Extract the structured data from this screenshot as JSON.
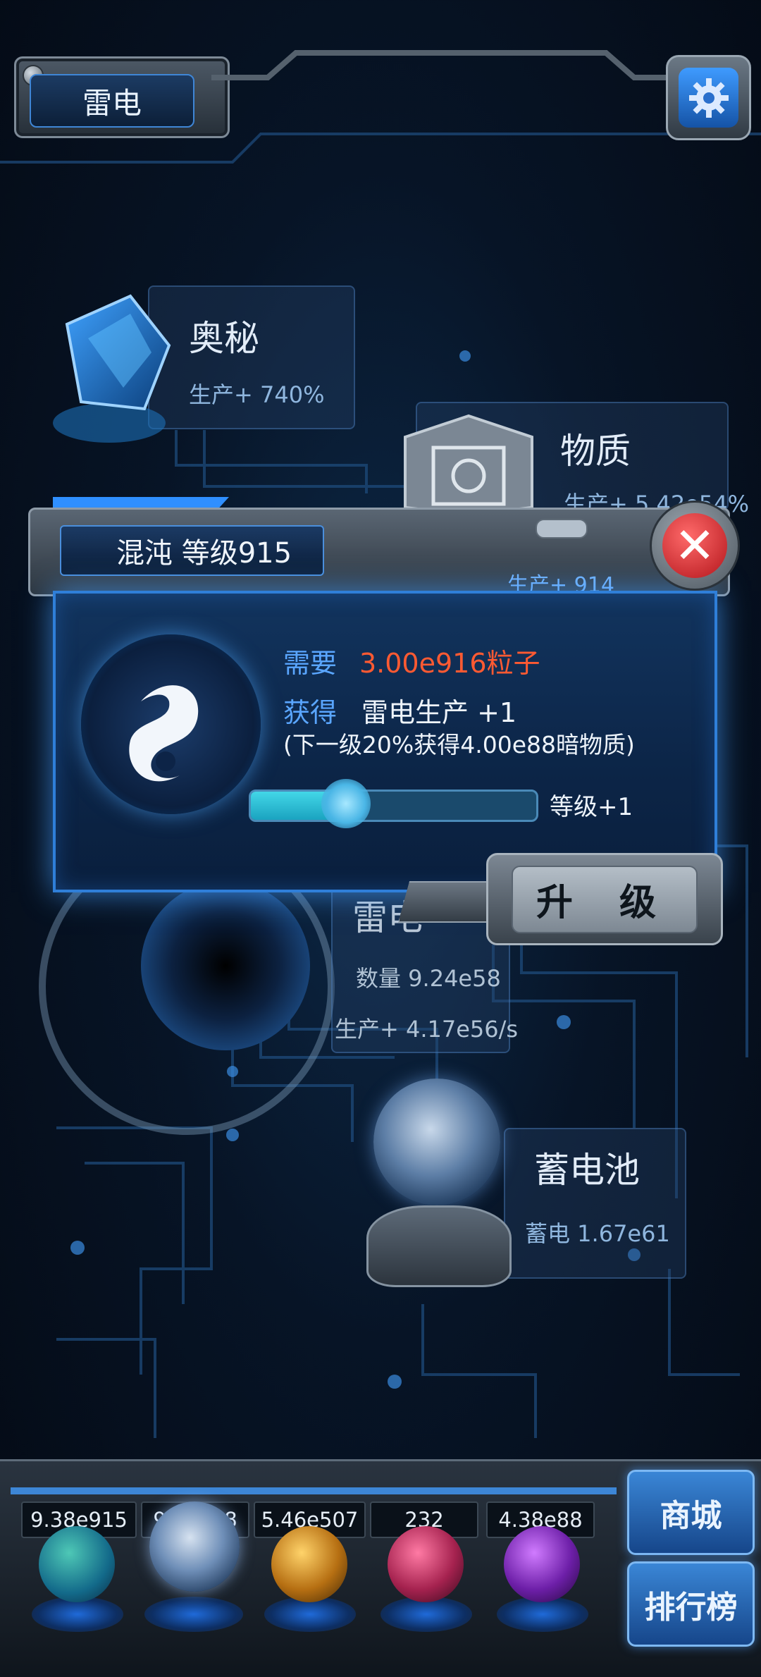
{
  "header": {
    "title": "雷电",
    "settings_icon": "gear-icon"
  },
  "cards": {
    "mystery": {
      "title": "奥秘",
      "production": "生产+ 740%"
    },
    "matter": {
      "title": "物质",
      "production": "生产+ 5.42e54%"
    },
    "thunder": {
      "title": "雷电",
      "quantity": "数量 9.24e58",
      "production": "生产+ 4.17e56/s"
    },
    "battery": {
      "title": "蓄电池",
      "charge": "蓄电 1.67e61"
    }
  },
  "dialog": {
    "title": "混沌 等级915",
    "production": "生产+ 914",
    "need_label": "需要",
    "need_value": "3.00e916粒子",
    "gain_label": "获得",
    "gain_value": "雷电生产 +1",
    "next_level_note": "(下一级20%获得4.00e88暗物质)",
    "progress_fraction": 0.34,
    "level_gain": "等级+1",
    "upgrade_button": "升 级",
    "close_icon": "close-icon"
  },
  "dock": {
    "counters": [
      "9.38e915",
      "9.24e58",
      "5.46e507",
      "232",
      "4.38e88"
    ],
    "shop_button": "商城",
    "ranking_button": "排行榜"
  },
  "colors": {
    "accent_blue": "#2f7fd9",
    "need_value_red": "#ff5a32",
    "label_blue": "#5aa6ff",
    "progress_cyan": "#43d7e8"
  }
}
